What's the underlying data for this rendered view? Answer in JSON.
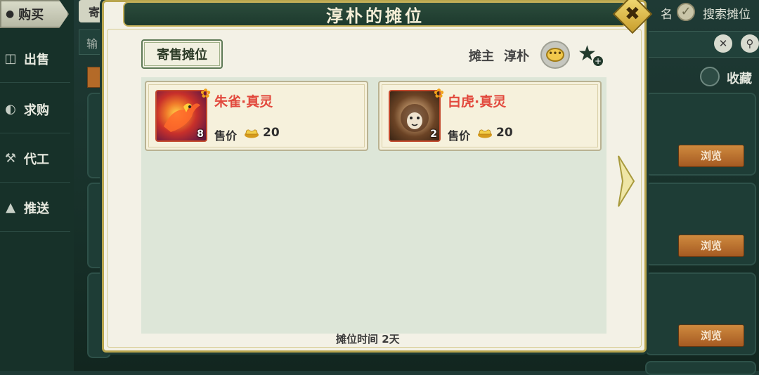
{
  "background": {
    "buy_tab": "购买",
    "sidebar": [
      {
        "label": "出售",
        "icon": "sell-icon"
      },
      {
        "label": "求购",
        "icon": "bowl-icon"
      },
      {
        "label": "代工",
        "icon": "anvil-icon"
      },
      {
        "label": "推送",
        "icon": "push-icon"
      }
    ],
    "tab2_partial": "寄",
    "input_partial": "输",
    "header_name_partial": "名",
    "search_stall": "搜索摊位",
    "favorites": "收藏",
    "browse_label": "浏览"
  },
  "modal": {
    "title": "淳朴的摊位",
    "close_icon": "close-icon",
    "consign_tab": "寄售摊位",
    "owner_label": "摊主",
    "owner_name": "淳朴",
    "items": [
      {
        "name": "朱雀·真灵",
        "quantity": "8",
        "price_label": "售价",
        "price": "20",
        "icon": "phoenix-icon"
      },
      {
        "name": "白虎·真灵",
        "quantity": "2",
        "price_label": "售价",
        "price": "20",
        "icon": "white-tiger-icon"
      }
    ],
    "stall_time": "摊位时间 2天"
  },
  "colors": {
    "accent_gold": "#c7b25a",
    "item_name_red": "#e2493d",
    "title_bar_green": "#2c4c3c"
  }
}
